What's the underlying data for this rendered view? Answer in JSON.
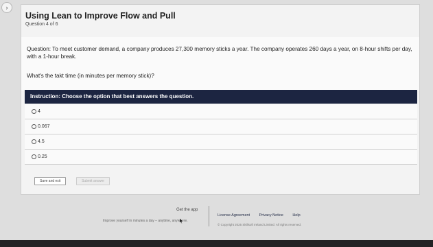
{
  "header": {
    "expand_glyph": "›",
    "title": "Using Lean to Improve Flow and Pull",
    "subtitle": "Question 4 of 6"
  },
  "question": {
    "text": "Question: To meet customer demand, a company produces 27,300 memory sticks a year. The company operates 260 days a year, on 8-hour shifts per day, with a 1-hour break.",
    "ask": "What's the takt time (in minutes per memory stick)?"
  },
  "instruction": "Instruction: Choose the option that best answers the question.",
  "options": [
    {
      "label": "4"
    },
    {
      "label": "0.067"
    },
    {
      "label": "4.5"
    },
    {
      "label": "0.25"
    }
  ],
  "actions": {
    "save_label": "Save and exit",
    "submit_label": "Submit answer"
  },
  "footer": {
    "get_app": "Get the app",
    "tagline": "Improve yourself in minutes a day – anytime, anywhere.",
    "links": [
      "License Agreement",
      "Privacy Notice",
      "Help"
    ],
    "copyright": "© Copyright 2025 Skillsoft Ireland Limited. All rights reserved."
  },
  "colors": {
    "instruction_bg": "#1c2541",
    "card_bg": "#f3f3f3",
    "page_bg": "#dedede"
  }
}
